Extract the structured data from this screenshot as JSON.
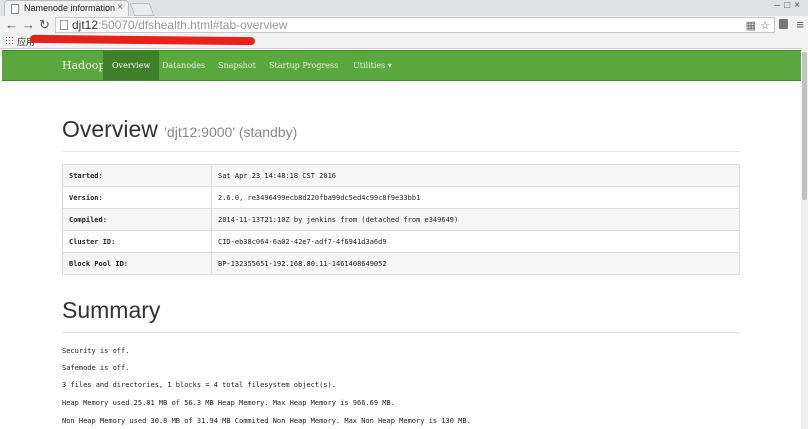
{
  "browser": {
    "tab_title": "Namenode information",
    "url_host": "djt12",
    "url_rest": ":50070/dfshealth.html#tab-overview",
    "apps_label": "应用"
  },
  "navbar": {
    "brand": "Hadoop",
    "items": [
      "Overview",
      "Datanodes",
      "Snapshot",
      "Startup Progress",
      "Utilities ▾"
    ]
  },
  "overview": {
    "title": "Overview",
    "subtitle": "'djt12:9000' (standby)",
    "rows": [
      {
        "label": "Started:",
        "value": "Sat Apr 23 14:48:18 CST 2016"
      },
      {
        "label": "Version:",
        "value": "2.6.0, re3496499ecb8d220fba99dc5ed4c99c8f9e33bb1"
      },
      {
        "label": "Compiled:",
        "value": "2014-11-13T21:10Z by jenkins from (detached from e349649)"
      },
      {
        "label": "Cluster ID:",
        "value": "CID-eb38c064-6a02-42e7-adf7-4f6941d3a6d9"
      },
      {
        "label": "Block Pool ID:",
        "value": "BP-132355651-192.168.80.11-1461408649052"
      }
    ]
  },
  "summary": {
    "title": "Summary",
    "lines": [
      "Security is off.",
      "Safemode is off.",
      "3 files and directories, 1 blocks = 4 total filesystem object(s).",
      "Heap Memory used 25.81 MB of 56.3 MB Heap Memory. Max Heap Memory is 966.69 MB.",
      "Non Heap Memory used 30.8 MB of 31.94 MB Commited Non Heap Memory. Max Non Heap Memory is 130 MB."
    ]
  }
}
